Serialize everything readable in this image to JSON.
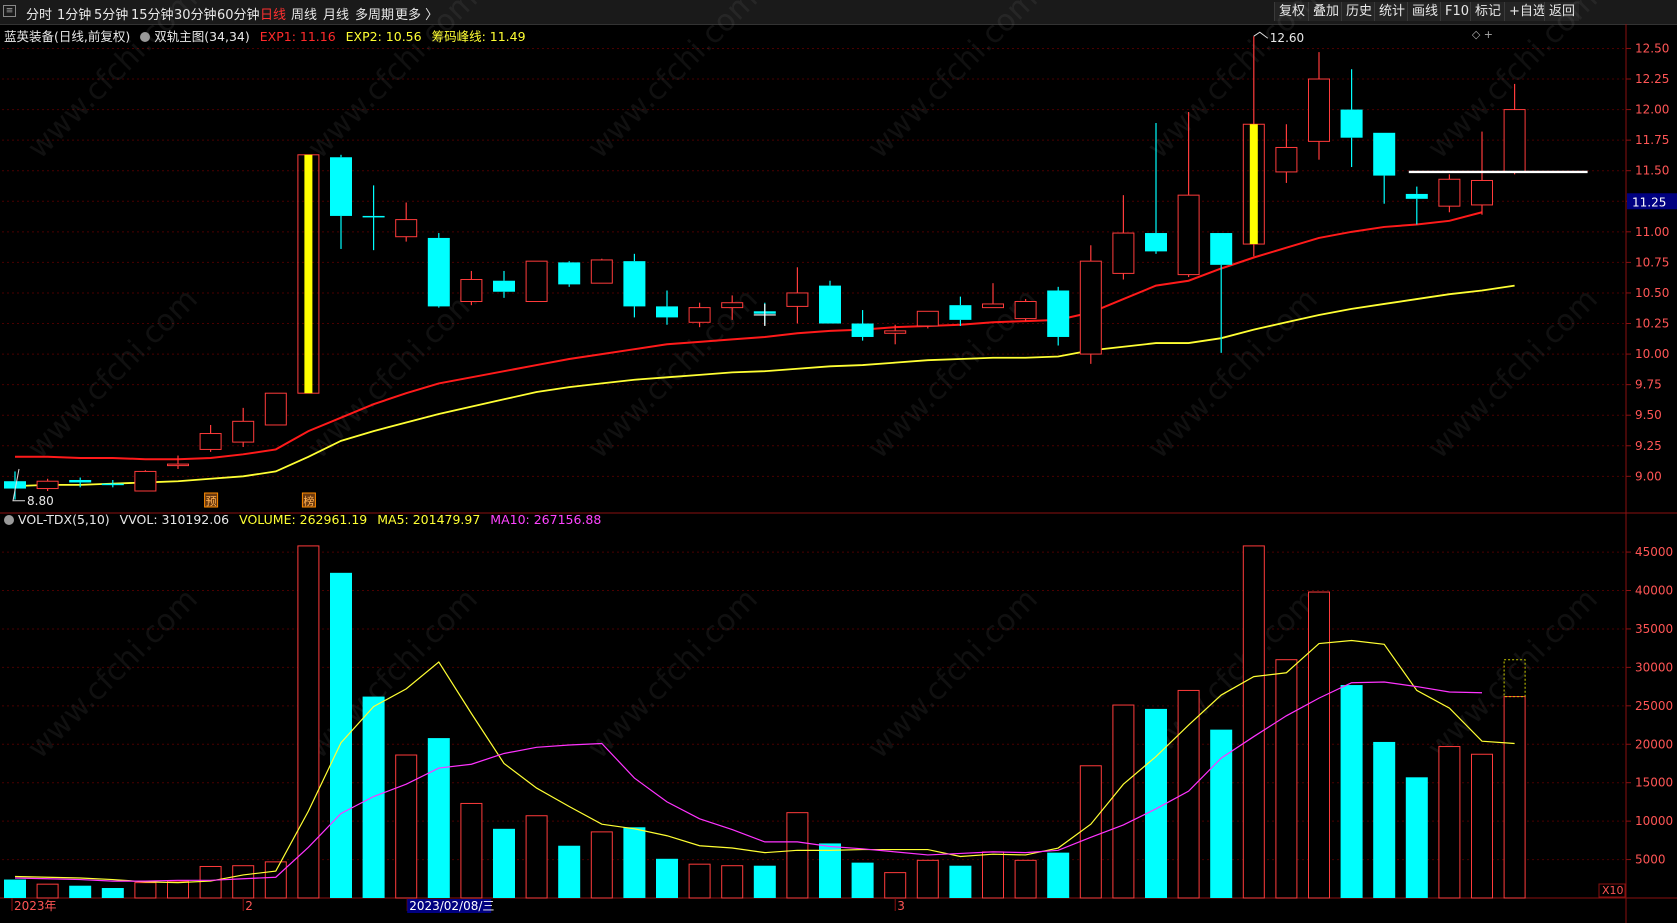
{
  "topbar": {
    "tabs": [
      {
        "label": "分时",
        "active": false
      },
      {
        "label": "1分钟",
        "active": false
      },
      {
        "label": "5分钟",
        "active": false
      },
      {
        "label": "15分钟",
        "active": false
      },
      {
        "label": "30分钟",
        "active": false
      },
      {
        "label": "60分钟",
        "active": false
      },
      {
        "label": "日线",
        "active": true
      },
      {
        "label": "周线",
        "active": false
      },
      {
        "label": "月线",
        "active": false
      },
      {
        "label": "多周期",
        "active": false
      },
      {
        "label": "更多 〉",
        "active": false
      }
    ],
    "right_buttons": [
      "复权",
      "叠加",
      "历史",
      "统计",
      "画线",
      "F10",
      "标记",
      "+自选",
      "返回"
    ]
  },
  "main_header": {
    "stock": "蓝英装备(日线,前复权)",
    "indicator": "双轨主图(34,34)",
    "exp1": "EXP1: 11.16",
    "exp2": "EXP2: 10.56",
    "chip": "筹码峰线: 11.49"
  },
  "vol_header": {
    "indicator": "VOL-TDX(5,10)",
    "vvol": "VVOL: 310192.06",
    "volume": "VOLUME: 262961.19",
    "ma5": "MA5: 201479.97",
    "ma10": "MA10: 267156.88"
  },
  "colors": {
    "up": "#ff3b3b",
    "down": "#00ffff",
    "exp1": "#ff1a1a",
    "exp2": "#ffff33",
    "ma5": "#ffff33",
    "ma10": "#ff33ff",
    "grid": "#4a0000",
    "axis_text": "#ff5555",
    "limit_up": "#ffff00",
    "chip_line": "#ffffff"
  },
  "chart_data": [
    {
      "type": "candlestick",
      "title": "蓝英装备(日线,前复权)",
      "ylim": [
        8.7,
        12.7
      ],
      "y_ticks": [
        "9.00",
        "9.25",
        "9.50",
        "9.75",
        "10.00",
        "10.25",
        "10.50",
        "10.75",
        "11.00",
        "11.25",
        "11.50",
        "11.75",
        "12.00",
        "12.25",
        "12.50"
      ],
      "current_price": "11.25",
      "max_label": "12.60",
      "min_label": "8.80",
      "x_labels": [
        "2023年",
        "2",
        "2023/02/08/三",
        "3"
      ],
      "markers": [
        "预",
        "榜"
      ],
      "candles": [
        {
          "o": 8.96,
          "c": 8.9,
          "h": 9.04,
          "l": 8.81
        },
        {
          "o": 8.9,
          "c": 8.96,
          "h": 8.98,
          "l": 8.88
        },
        {
          "o": 8.97,
          "c": 8.95,
          "h": 8.99,
          "l": 8.91
        },
        {
          "o": 8.94,
          "c": 8.93,
          "h": 8.97,
          "l": 8.91
        },
        {
          "o": 8.88,
          "c": 9.04,
          "h": 9.05,
          "l": 8.88
        },
        {
          "o": 9.09,
          "c": 9.1,
          "h": 9.17,
          "l": 9.06
        },
        {
          "o": 9.22,
          "c": 9.35,
          "h": 9.42,
          "l": 9.2
        },
        {
          "o": 9.28,
          "c": 9.45,
          "h": 9.56,
          "l": 9.24
        },
        {
          "o": 9.42,
          "c": 9.68,
          "h": 9.68,
          "l": 9.42
        },
        {
          "o": 9.68,
          "c": 11.63,
          "h": 11.63,
          "l": 9.68,
          "limit": true
        },
        {
          "o": 11.61,
          "c": 11.13,
          "h": 11.63,
          "l": 10.86
        },
        {
          "o": 11.13,
          "c": 11.12,
          "h": 11.38,
          "l": 10.85
        },
        {
          "o": 10.96,
          "c": 11.1,
          "h": 11.24,
          "l": 10.92
        },
        {
          "o": 10.95,
          "c": 10.39,
          "h": 10.99,
          "l": 10.38
        },
        {
          "o": 10.43,
          "c": 10.61,
          "h": 10.68,
          "l": 10.4
        },
        {
          "o": 10.6,
          "c": 10.51,
          "h": 10.68,
          "l": 10.46
        },
        {
          "o": 10.43,
          "c": 10.76,
          "h": 10.76,
          "l": 10.43
        },
        {
          "o": 10.75,
          "c": 10.57,
          "h": 10.76,
          "l": 10.55
        },
        {
          "o": 10.58,
          "c": 10.77,
          "h": 10.78,
          "l": 10.58
        },
        {
          "o": 10.76,
          "c": 10.39,
          "h": 10.82,
          "l": 10.3
        },
        {
          "o": 10.39,
          "c": 10.3,
          "h": 10.52,
          "l": 10.24
        },
        {
          "o": 10.26,
          "c": 10.38,
          "h": 10.42,
          "l": 10.22
        },
        {
          "o": 10.38,
          "c": 10.42,
          "h": 10.48,
          "l": 10.28
        },
        {
          "o": 10.35,
          "c": 10.33,
          "h": 10.42,
          "l": 10.24
        },
        {
          "o": 10.39,
          "c": 10.5,
          "h": 10.71,
          "l": 10.25
        },
        {
          "o": 10.56,
          "c": 10.25,
          "h": 10.6,
          "l": 10.25
        },
        {
          "o": 10.25,
          "c": 10.14,
          "h": 10.36,
          "l": 10.11
        },
        {
          "o": 10.17,
          "c": 10.19,
          "h": 10.24,
          "l": 10.08
        },
        {
          "o": 10.23,
          "c": 10.35,
          "h": 10.35,
          "l": 10.21
        },
        {
          "o": 10.4,
          "c": 10.28,
          "h": 10.47,
          "l": 10.23
        },
        {
          "o": 10.38,
          "c": 10.41,
          "h": 10.58,
          "l": 10.38
        },
        {
          "o": 10.29,
          "c": 10.43,
          "h": 10.45,
          "l": 10.27
        },
        {
          "o": 10.52,
          "c": 10.14,
          "h": 10.55,
          "l": 10.07
        },
        {
          "o": 10.0,
          "c": 10.76,
          "h": 10.89,
          "l": 9.92
        },
        {
          "o": 10.66,
          "c": 10.99,
          "h": 11.3,
          "l": 10.61
        },
        {
          "o": 10.99,
          "c": 10.84,
          "h": 11.89,
          "l": 10.82
        },
        {
          "o": 10.65,
          "c": 11.3,
          "h": 11.98,
          "l": 10.63
        },
        {
          "o": 10.99,
          "c": 10.73,
          "h": 10.99,
          "l": 10.01
        },
        {
          "o": 10.9,
          "c": 11.88,
          "h": 12.6,
          "l": 10.8,
          "limit": true
        },
        {
          "o": 11.49,
          "c": 11.69,
          "h": 11.88,
          "l": 11.4
        },
        {
          "o": 11.74,
          "c": 12.25,
          "h": 12.47,
          "l": 11.59
        },
        {
          "o": 12.0,
          "c": 11.77,
          "h": 12.33,
          "l": 11.53
        },
        {
          "o": 11.81,
          "c": 11.46,
          "h": 11.81,
          "l": 11.23
        },
        {
          "o": 11.31,
          "c": 11.27,
          "h": 11.37,
          "l": 11.06
        },
        {
          "o": 11.21,
          "c": 11.43,
          "h": 11.47,
          "l": 11.16
        },
        {
          "o": 11.22,
          "c": 11.42,
          "h": 11.82,
          "l": 11.14
        },
        {
          "o": 11.49,
          "c": 12.0,
          "h": 12.21,
          "l": 11.47
        }
      ],
      "exp1": [
        9.16,
        9.16,
        9.15,
        9.15,
        9.14,
        9.14,
        9.15,
        9.18,
        9.22,
        9.37,
        9.48,
        9.59,
        9.68,
        9.76,
        9.81,
        9.86,
        9.91,
        9.96,
        10.0,
        10.04,
        10.08,
        10.1,
        10.12,
        10.14,
        10.17,
        10.19,
        10.2,
        10.22,
        10.23,
        10.24,
        10.26,
        10.27,
        10.28,
        10.34,
        10.45,
        10.56,
        10.6,
        10.7,
        10.79,
        10.87,
        10.95,
        11.0,
        11.04,
        11.06,
        11.09,
        11.16
      ],
      "exp2": [
        8.92,
        8.93,
        8.93,
        8.94,
        8.95,
        8.96,
        8.98,
        9.0,
        9.04,
        9.16,
        9.29,
        9.37,
        9.44,
        9.51,
        9.57,
        9.63,
        9.69,
        9.73,
        9.76,
        9.79,
        9.81,
        9.83,
        9.85,
        9.86,
        9.88,
        9.9,
        9.91,
        9.93,
        9.95,
        9.96,
        9.97,
        9.97,
        9.98,
        10.03,
        10.06,
        10.09,
        10.09,
        10.13,
        10.2,
        10.26,
        10.32,
        10.37,
        10.41,
        10.45,
        10.49,
        10.52,
        10.56
      ],
      "chip_line": 11.49
    },
    {
      "type": "bar",
      "title": "VOL-TDX(5,10)",
      "ylim": [
        0,
        48000
      ],
      "y_ticks": [
        "5000",
        "10000",
        "15000",
        "20000",
        "25000",
        "30000",
        "35000",
        "40000",
        "45000"
      ],
      "unit": "X10",
      "volumes": [
        2400,
        1800,
        1600,
        1300,
        2000,
        2200,
        4100,
        4200,
        4700,
        45800,
        42300,
        26200,
        18600,
        20800,
        12300,
        9000,
        10700,
        6800,
        8600,
        9200,
        5100,
        4400,
        4200,
        4200,
        11100,
        7100,
        4600,
        3300,
        4900,
        4200,
        6000,
        4900,
        5900,
        17200,
        25100,
        24600,
        27000,
        21900,
        45800,
        31000,
        39800,
        27700,
        20300,
        15700,
        19700,
        18700,
        26200
      ],
      "ma5": [
        2800,
        2700,
        2600,
        2400,
        2100,
        2000,
        2200,
        3000,
        3500,
        11300,
        20200,
        24900,
        27200,
        30700,
        24000,
        17500,
        14300,
        11900,
        9600,
        9000,
        8100,
        6800,
        6500,
        5900,
        6200,
        6200,
        6300,
        6300,
        6300,
        5400,
        5700,
        5600,
        6500,
        9600,
        14800,
        18400,
        22500,
        26400,
        28800,
        29300,
        33100,
        33500,
        33000,
        27000,
        24700,
        20400,
        20100
      ],
      "ma10": [
        2600,
        2500,
        2400,
        2200,
        2200,
        2300,
        2300,
        2500,
        2700,
        6600,
        11000,
        13200,
        14800,
        16900,
        17400,
        18800,
        19600,
        19900,
        20100,
        15600,
        12500,
        10300,
        8900,
        7300,
        7300,
        6700,
        6400,
        6000,
        5600,
        5800,
        6000,
        5900,
        6200,
        7900,
        9500,
        11600,
        13900,
        18200,
        21000,
        23700,
        26000,
        28000,
        28100,
        27500,
        26800,
        26700
      ]
    }
  ]
}
